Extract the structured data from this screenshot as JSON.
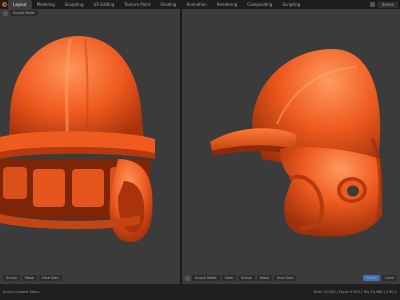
{
  "topbar": {
    "tabs": [
      "Layout",
      "Modeling",
      "Sculpting",
      "UV Editing",
      "Texture Paint",
      "Shading",
      "Animation",
      "Rendering",
      "Compositing",
      "Scripting"
    ],
    "scene_label": "Scene"
  },
  "left_viewport": {
    "mode_label": "Sculpt Mode",
    "footer_items": [
      "Sculpt",
      "Mask",
      "Face Sets"
    ]
  },
  "right_viewport": {
    "header_items": [
      "Sculpt Mode",
      "View",
      "Sculpt",
      "Mask",
      "Face Sets"
    ],
    "footer_items": [
      "Object",
      "Local"
    ]
  },
  "statusbar": {
    "left": "Sculpt Context Menu",
    "right": "Verts 10,000 | Faces 9,993 | Tris 19,986 | 2.90.1"
  },
  "colors": {
    "helmet": "#ef5a1f",
    "helmet_dark": "#a8330c",
    "helmet_light": "#ff8a4a",
    "viewport_bg": "#3b3b3b"
  }
}
